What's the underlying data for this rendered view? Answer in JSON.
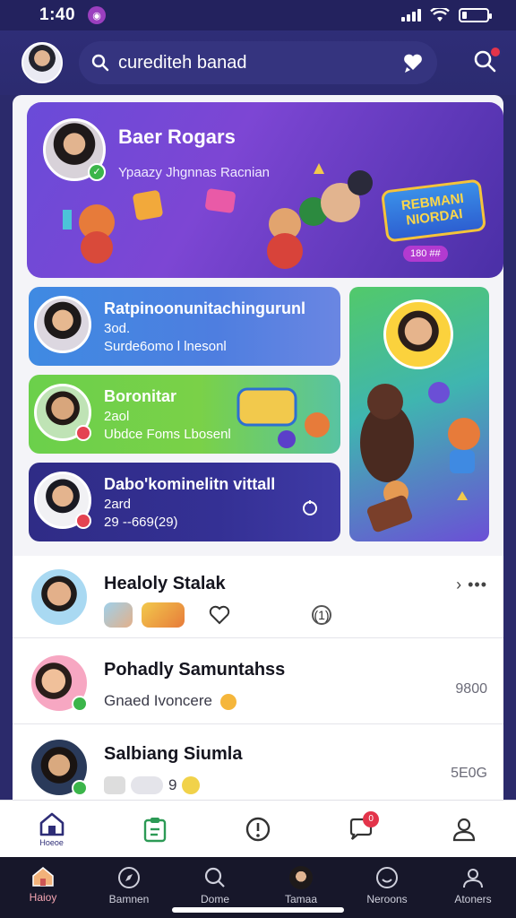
{
  "status": {
    "time": "1:40"
  },
  "header": {
    "search_placeholder": "curediteh banad"
  },
  "hero": {
    "title": "Baer Rogars",
    "subtitle": "Ypaazy Jhgnnas Racnian",
    "banner": "REBMANI NIORDAI",
    "pill": "180 ##"
  },
  "cards": [
    {
      "title": "Ratpinoonunitachingurunl",
      "meta": "3od.",
      "desc": "Surde6omo l lnesonl"
    },
    {
      "title": "Boronitar",
      "meta": "2aol",
      "desc": "Ubdce Foms Lbosenl"
    },
    {
      "title": "Dabo'kominelitn vittall",
      "meta": "2ard",
      "desc": "29 --669(29)"
    }
  ],
  "list": [
    {
      "name": "Healoly Stalak",
      "more": "› •••",
      "chip_text": "",
      "reaction": "(1)"
    },
    {
      "name": "Pohadly Samuntahss",
      "sub": "Gnaed Ivoncere",
      "time": "9800"
    },
    {
      "name": "Salbiang Siumla",
      "sub": "9",
      "time": "5E0G"
    }
  ],
  "tabbar": {
    "home_label": "Hoeoe",
    "notif_count": "0"
  },
  "navbar": [
    {
      "label": "Haioy"
    },
    {
      "label": "Bamnen"
    },
    {
      "label": "Dome"
    },
    {
      "label": "Tamaa"
    },
    {
      "label": "Neroons"
    },
    {
      "label": "Atoners"
    }
  ],
  "colors": {
    "primary": "#2e2d77",
    "accent": "#e3344a",
    "success": "#3bb54a"
  }
}
